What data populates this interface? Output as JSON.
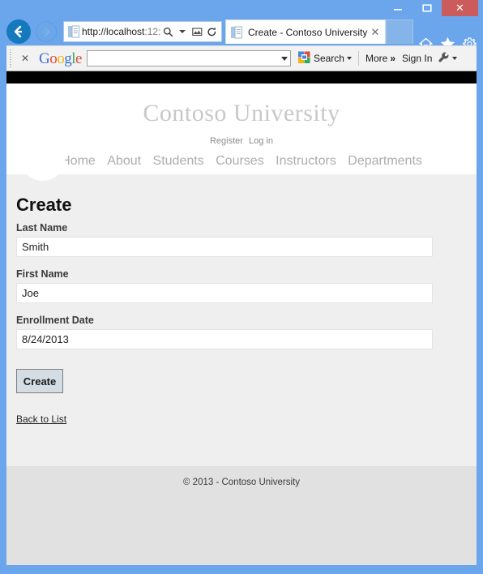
{
  "browser": {
    "window_controls": {
      "minimize": "minimize-button",
      "maximize": "maximize-button",
      "close_label": "✕"
    },
    "back_label": "back-button",
    "forward_label": "forward-button",
    "address": {
      "url_main": "http://localhost",
      "url_dim": ":12:",
      "full_url": "http://localhost:12:",
      "search_icon": "search-magnifier-icon",
      "compat_icon": "compatibility-view-icon",
      "refresh_icon": "refresh-icon"
    },
    "tab": {
      "title": "Create - Contoso University",
      "close_label": "✕"
    },
    "chrome_icons": {
      "home": "home-icon",
      "favorites": "favorites-star-icon",
      "tools": "tools-gear-icon"
    }
  },
  "google_toolbar": {
    "close_label": "✕",
    "logo": {
      "l1": "G",
      "l2": "o",
      "l3": "o",
      "l4": "g",
      "l5": "l",
      "l6": "e"
    },
    "search_input_value": "",
    "search_label": "Search",
    "more_label": "More",
    "more_chevron": "»",
    "signin_label": "Sign In",
    "wrench_icon": "wrench-icon"
  },
  "page": {
    "brand": "Contoso University",
    "auth_links": [
      {
        "label": "Register"
      },
      {
        "label": "Log in"
      }
    ],
    "nav_links": [
      {
        "label": "Home"
      },
      {
        "label": "About"
      },
      {
        "label": "Students"
      },
      {
        "label": "Courses"
      },
      {
        "label": "Instructors"
      },
      {
        "label": "Departments"
      }
    ],
    "title": "Create",
    "form": {
      "fields": [
        {
          "label": "Last Name",
          "value": "Smith",
          "placeholder": ""
        },
        {
          "label": "First Name",
          "value": "Joe",
          "placeholder": ""
        },
        {
          "label": "Enrollment Date",
          "value": "8/24/2013",
          "placeholder": ""
        }
      ],
      "submit_label": "Create"
    },
    "back_link": "Back to List",
    "footer": "© 2013 - Contoso University"
  },
  "colors": {
    "window_frame": "#6ba6ec",
    "close_button": "#cc5c5c",
    "content_bg": "#efefef",
    "footer_bg": "#e1e1e1",
    "brand_gray": "#c8c8c8",
    "nav_gray": "#adadad",
    "button_bg": "#d4dde4"
  }
}
